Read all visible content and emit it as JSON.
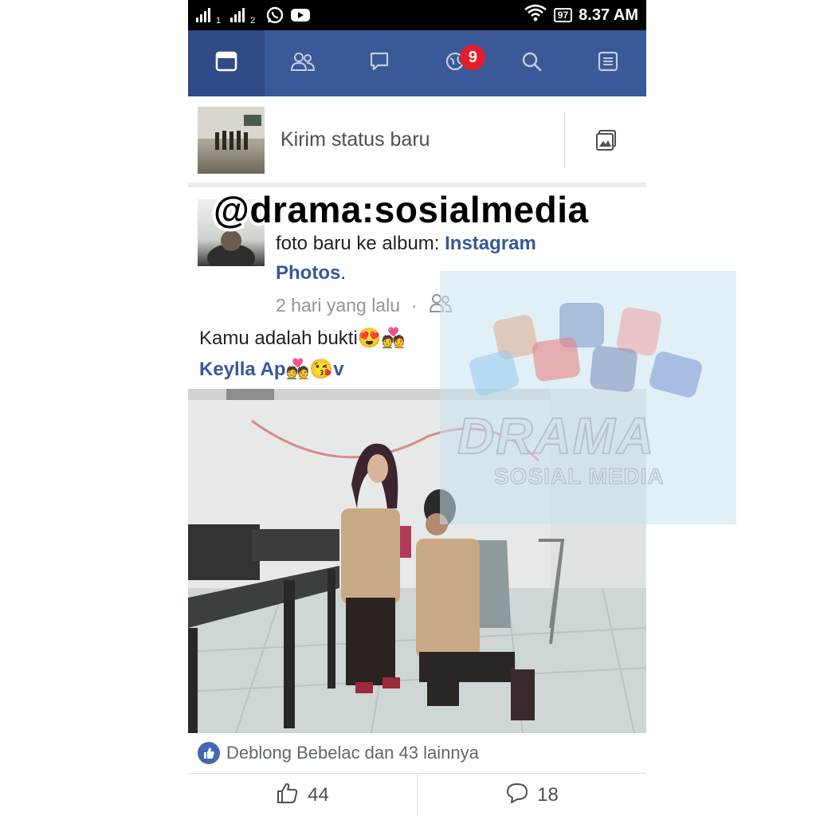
{
  "status_bar": {
    "sim1": "1",
    "sim2": "2",
    "battery": "97",
    "time": "8.37 AM",
    "icons": [
      "signal-icon",
      "whatsapp-icon",
      "youtube-icon",
      "wifi-icon",
      "battery-icon"
    ]
  },
  "nav": {
    "tabs": [
      {
        "name": "news-feed",
        "icon": "news-feed-icon"
      },
      {
        "name": "friends",
        "icon": "friends-icon"
      },
      {
        "name": "messages",
        "icon": "chat-icon"
      },
      {
        "name": "notifications",
        "icon": "globe-icon"
      },
      {
        "name": "search",
        "icon": "search-icon"
      },
      {
        "name": "menu",
        "icon": "menu-list-icon"
      }
    ],
    "notification_count": "9",
    "accent": "#3b5998",
    "badge_color": "#e41d2e"
  },
  "composer": {
    "placeholder": "Kirim status baru",
    "photo_icon": "photo-icon"
  },
  "post": {
    "header_line_prefix": "foto baru ke album: ",
    "album_part1": "Instagram",
    "album_part2": "Photos",
    "album_suffix": ".",
    "time": "2 hari yang lalu",
    "time_separator": "·",
    "audience_icon": "friends-audience-icon",
    "caption_line1": "Kamu adalah bukti😍💑",
    "caption_name": "Keylla Ap💑😘v",
    "reactions_text": "Deblong Bebelac dan 43 lainnya",
    "like_count": "44",
    "comment_count": "18"
  },
  "overlay": {
    "handle": "@drama:sosialmedia",
    "logo_title": "DRAMA",
    "logo_subtitle": "SOSIAL MEDIA"
  }
}
